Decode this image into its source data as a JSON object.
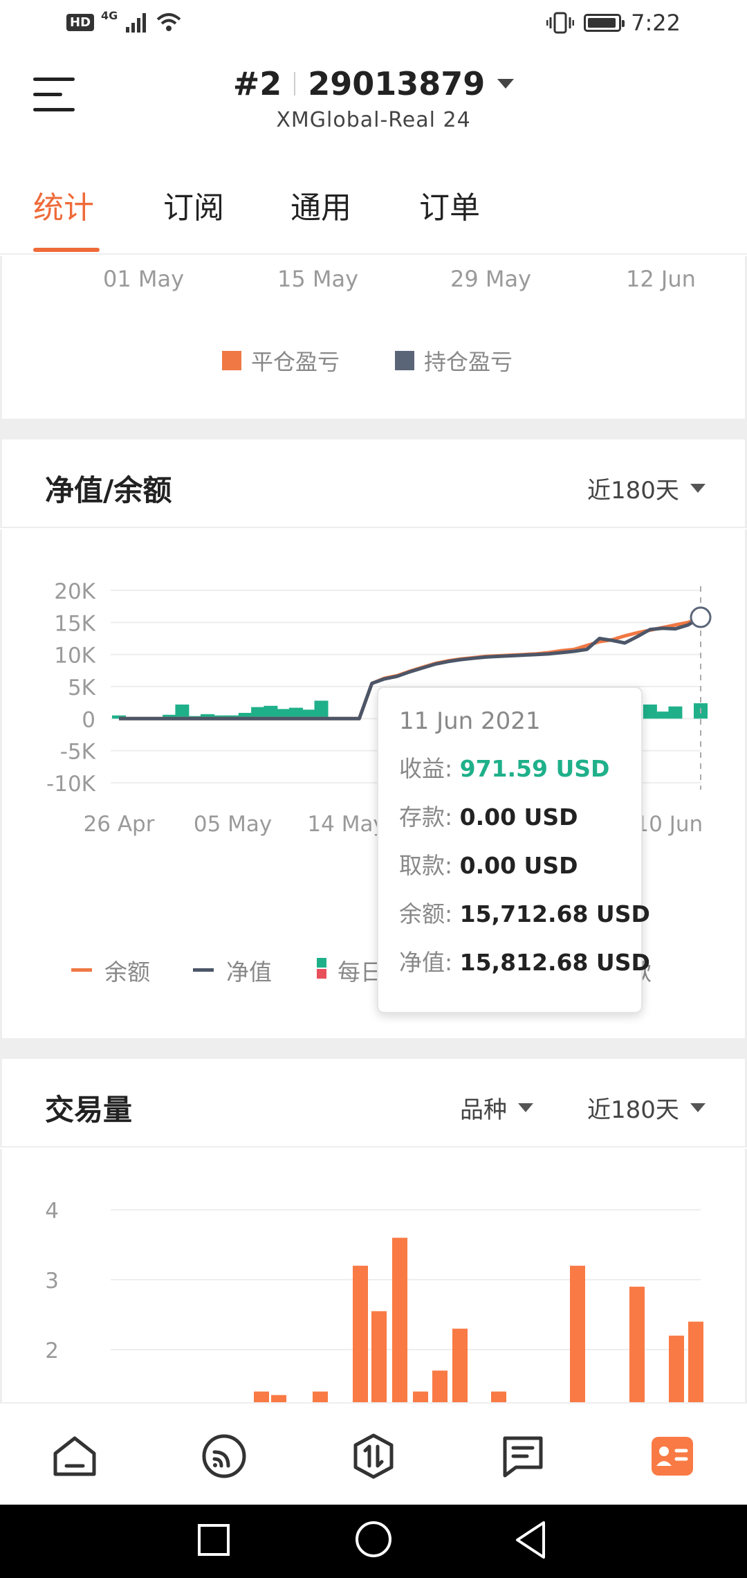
{
  "status_bar": {
    "hd": "HD",
    "network": "4G",
    "time": "7:22"
  },
  "header": {
    "account_number": "#2",
    "account_id": "29013879",
    "server": "XMGlobal-Real 24"
  },
  "tabs": [
    "统计",
    "订阅",
    "通用",
    "订单"
  ],
  "active_tab": 0,
  "pl_section": {
    "x_ticks": [
      "01 May",
      "15 May",
      "29 May",
      "12 Jun"
    ],
    "legend": [
      {
        "label": "平仓盈亏",
        "color": "#f07844"
      },
      {
        "label": "持仓盈亏",
        "color": "#5a6578"
      }
    ]
  },
  "equity_section": {
    "title": "净值/余额",
    "range_label": "近180天"
  },
  "volume_section": {
    "title": "交易量",
    "symbol_label": "品种",
    "range_label": "近180天"
  },
  "equity_legend": [
    {
      "label": "余额",
      "color": "#f07844"
    },
    {
      "label": "净值",
      "color": "#4c5668"
    },
    {
      "label": "每日",
      "color": "#1fb08a"
    },
    {
      "label": "取款",
      "color": "#4c5668"
    }
  ],
  "tooltip": {
    "date": "11 Jun 2021",
    "rows": [
      {
        "label": "收益:",
        "value": "971.59 USD"
      },
      {
        "label": "存款:",
        "value": "0.00 USD"
      },
      {
        "label": "取款:",
        "value": "0.00 USD"
      },
      {
        "label": "余额:",
        "value": "15,712.68 USD"
      },
      {
        "label": "净值:",
        "value": "15,812.68 USD"
      }
    ]
  },
  "chart_data": [
    {
      "type": "line",
      "y_ticks": [
        "20K",
        "15K",
        "10K",
        "5K",
        "0",
        "-5K",
        "-10K"
      ],
      "ylim": [
        -10000,
        20000
      ],
      "x_ticks": [
        "26 Apr",
        "05 May",
        "14 May",
        "",
        "",
        "10 Jun"
      ],
      "series": [
        {
          "name": "余额",
          "color": "#f07844",
          "x": [
            0,
            1,
            2,
            3,
            4,
            5,
            6,
            7,
            8,
            9,
            10,
            11,
            12,
            13,
            14,
            15,
            16,
            17,
            18,
            19,
            20,
            21,
            22,
            23,
            24,
            25,
            26,
            27,
            28,
            29,
            30,
            31,
            32,
            33,
            34,
            35,
            36,
            37,
            38,
            39,
            40,
            41,
            42,
            43,
            44,
            45,
            46
          ],
          "values": [
            0,
            0,
            0,
            0,
            0,
            0,
            0,
            0,
            0,
            0,
            0,
            0,
            0,
            0,
            0,
            0,
            0,
            0,
            0,
            0,
            5500,
            6300,
            6700,
            7400,
            8000,
            8600,
            9000,
            9300,
            9500,
            9700,
            9800,
            9900,
            10000,
            10100,
            10300,
            10600,
            10800,
            11400,
            12000,
            12300,
            12900,
            13400,
            13800,
            14200,
            14600,
            15000,
            15700
          ]
        },
        {
          "name": "净值",
          "color": "#4c5668",
          "x": [
            0,
            1,
            2,
            3,
            4,
            5,
            6,
            7,
            8,
            9,
            10,
            11,
            12,
            13,
            14,
            15,
            16,
            17,
            18,
            19,
            20,
            21,
            22,
            23,
            24,
            25,
            26,
            27,
            28,
            29,
            30,
            31,
            32,
            33,
            34,
            35,
            36,
            37,
            38,
            39,
            40,
            41,
            42,
            43,
            44,
            45,
            46
          ],
          "values": [
            0,
            0,
            0,
            0,
            0,
            0,
            0,
            0,
            0,
            0,
            0,
            0,
            0,
            0,
            0,
            0,
            0,
            0,
            0,
            0,
            5500,
            6200,
            6600,
            7300,
            7900,
            8500,
            8900,
            9200,
            9400,
            9600,
            9700,
            9800,
            9900,
            10000,
            10100,
            10300,
            10500,
            10800,
            12500,
            12200,
            11800,
            12800,
            13900,
            14100,
            14000,
            14600,
            15800
          ]
        },
        {
          "name": "每日",
          "color": "#1fb08a",
          "x": [
            0,
            2,
            4,
            5,
            6,
            7,
            8,
            9,
            10,
            11,
            12,
            13,
            14,
            15,
            16,
            17,
            18,
            19,
            20,
            21,
            22,
            23,
            24,
            25,
            26,
            27,
            28,
            29,
            30,
            31,
            32,
            33,
            34,
            35,
            36,
            37,
            38,
            39,
            40,
            41,
            42,
            43,
            44,
            45,
            46
          ],
          "values": [
            500,
            0,
            600,
            2200,
            400,
            700,
            500,
            500,
            900,
            1800,
            2000,
            1500,
            1700,
            1400,
            2800,
            0,
            0,
            0,
            0,
            0,
            0,
            0,
            0,
            0,
            0,
            0,
            0,
            0,
            0,
            0,
            0,
            0,
            0,
            0,
            0,
            0,
            0,
            0,
            0,
            0,
            2200,
            1100,
            1900,
            0,
            2400
          ]
        }
      ]
    },
    {
      "type": "bar",
      "y_ticks": [
        "4",
        "3",
        "2"
      ],
      "ylim": [
        1,
        4.2
      ],
      "x": [
        0,
        1,
        2,
        3,
        4,
        5,
        6,
        7,
        8,
        9,
        10,
        11,
        12,
        13,
        14,
        15,
        16,
        17,
        18,
        19,
        20,
        21,
        22,
        23,
        24,
        25,
        26,
        27,
        28,
        29,
        30,
        31,
        32,
        33,
        34,
        35,
        36,
        37,
        38,
        39,
        40,
        41,
        42,
        43,
        44,
        45,
        46
      ],
      "values": [
        0,
        0,
        0,
        0,
        0,
        0,
        0,
        0,
        0,
        0,
        0,
        0,
        0,
        0,
        0,
        0,
        0,
        0,
        0,
        0,
        0,
        0,
        0,
        0,
        0,
        0,
        0,
        0,
        0,
        0,
        0,
        0,
        0,
        0,
        0,
        0,
        0,
        0,
        0,
        0,
        0,
        0,
        0,
        0,
        0,
        0,
        0
      ],
      "series": [
        {
          "name": "",
          "color": "#f97a44",
          "x": [
            0,
            1,
            2,
            3,
            4,
            5,
            6,
            7,
            8,
            9,
            10,
            11,
            12,
            13,
            14,
            15,
            16,
            17,
            18,
            19,
            20
          ],
          "values": [
            1.4,
            1.35,
            1.4,
            3.2,
            2.55,
            3.6,
            1.4,
            1.7,
            2.3,
            1.4,
            3.2,
            2.9,
            2.2,
            2.4,
            0,
            0,
            0,
            0,
            0,
            0,
            0
          ]
        }
      ]
    }
  ]
}
